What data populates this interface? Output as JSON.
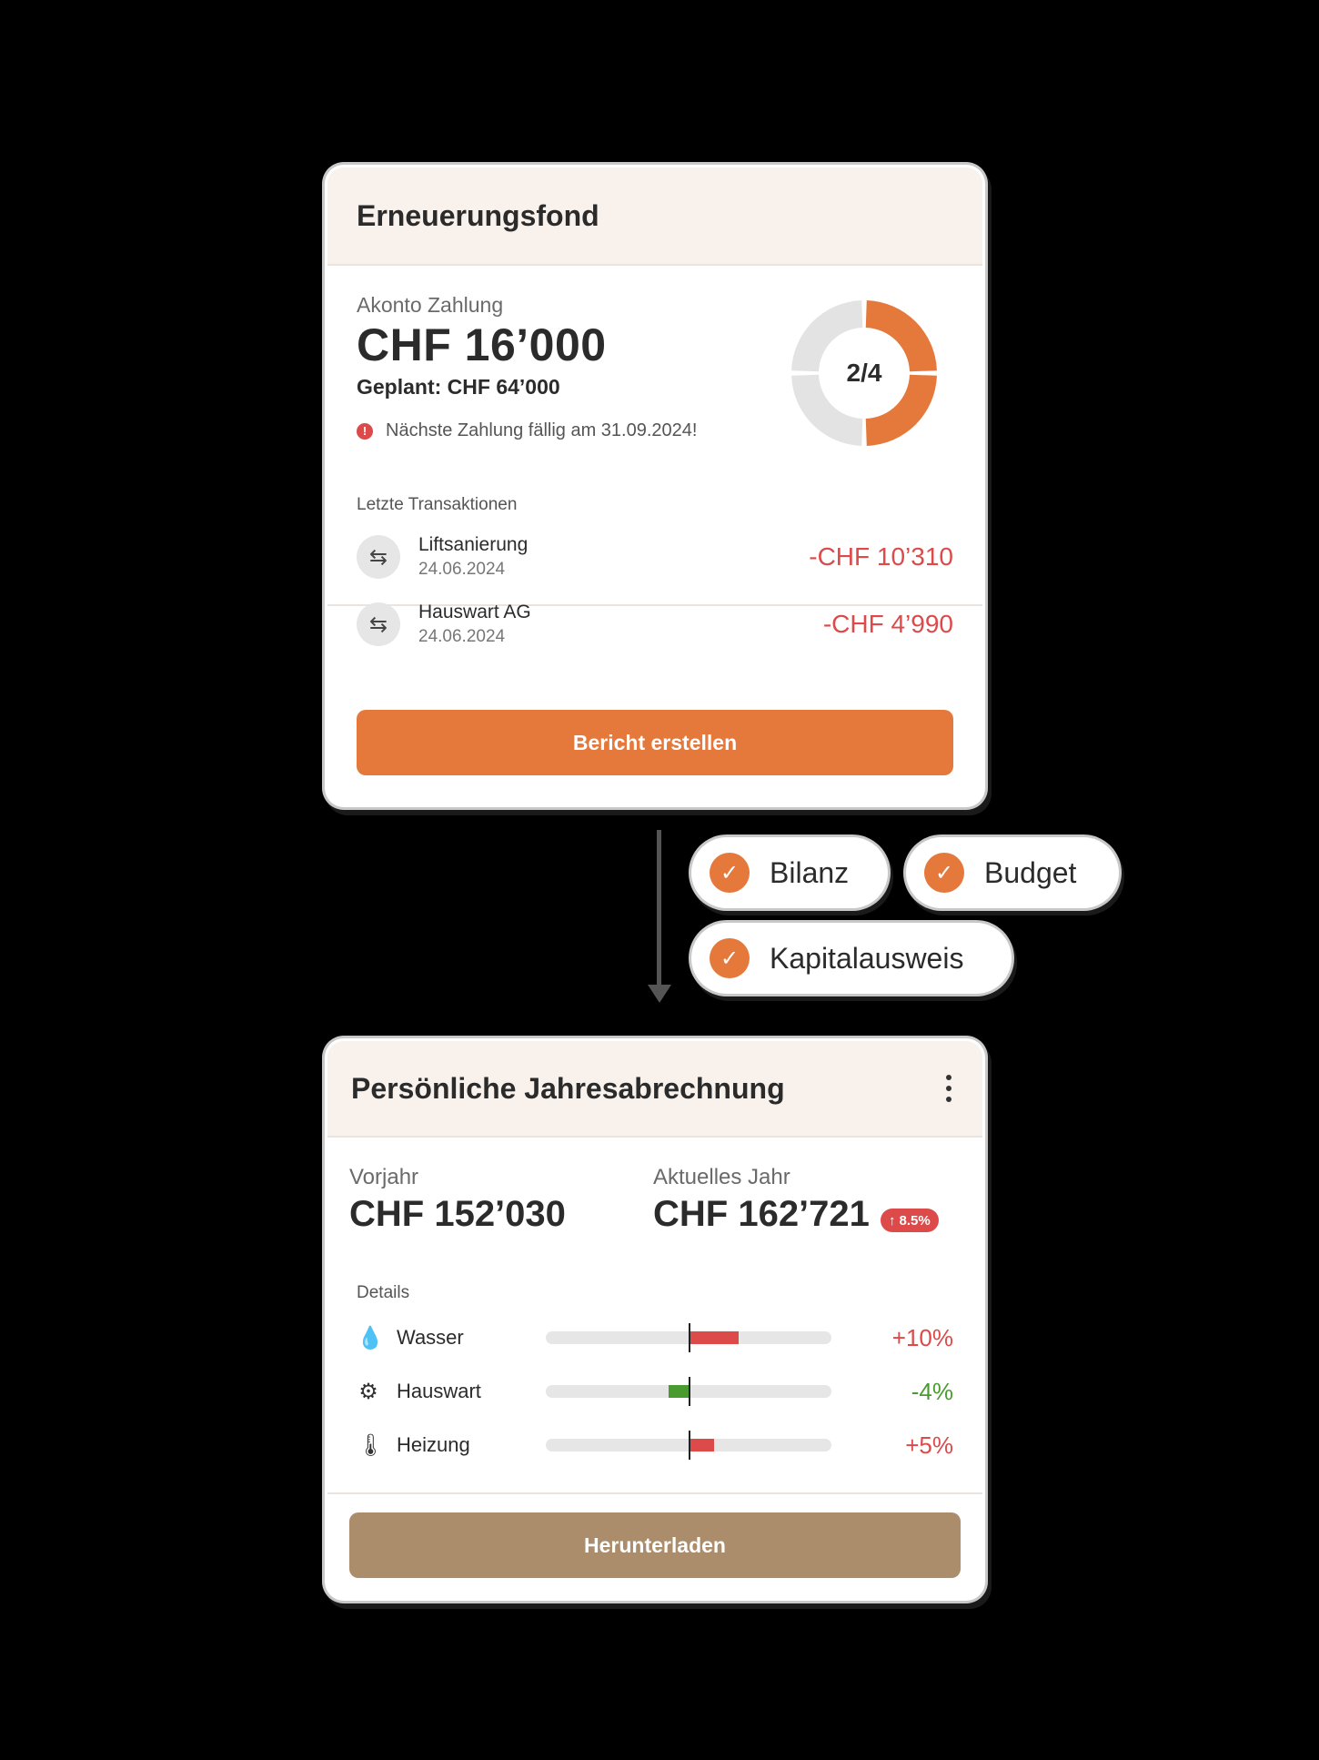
{
  "fund_card": {
    "title": "Erneuerungsfond",
    "akonto_label": "Akonto Zahlung",
    "akonto_amount": "CHF 16’000",
    "planned": "Geplant: CHF 64’000",
    "alert_text": "Nächste Zahlung fällig am 31.09.2024!",
    "progress": {
      "label": "2/4",
      "done": 2,
      "total": 4,
      "color_done": "#e5793c",
      "color_open": "#e3e3e3"
    },
    "transactions_label": "Letzte Transaktionen",
    "transactions": [
      {
        "name": "Liftsanierung",
        "date": "24.06.2024",
        "amount": "-CHF 10’310",
        "icon": "transfer-icon"
      },
      {
        "name": "Hauswart AG",
        "date": "24.06.2024",
        "amount": "-CHF 4’990",
        "icon": "transfer-icon"
      }
    ],
    "button_label": "Bericht erstellen",
    "accent": "#e5793c",
    "negative_color": "#dc4a4a"
  },
  "report_items": [
    {
      "label": "Bilanz",
      "checked": true
    },
    {
      "label": "Budget",
      "checked": true
    },
    {
      "label": "Kapitalausweis",
      "checked": true
    }
  ],
  "statement_card": {
    "title": "Persönliche Jahresabrechnung",
    "previous_label": "Vorjahr",
    "previous_amount": "CHF 152’030",
    "current_label": "Aktuelles Jahr",
    "current_amount": "CHF 162’721",
    "change_badge": "8.5%",
    "details_label": "Details",
    "details": [
      {
        "name": "Wasser",
        "icon": "water-drops-icon",
        "change_text": "+10%",
        "change": 10,
        "color": "#dc4a4a"
      },
      {
        "name": "Hauswart",
        "icon": "gear-icon",
        "change_text": "-4%",
        "change": -4,
        "color": "#4a9b2f"
      },
      {
        "name": "Heizung",
        "icon": "thermometer-icon",
        "change_text": "+5%",
        "change": 5,
        "color": "#dc4a4a"
      }
    ],
    "button_label": "Herunterladen",
    "button_color": "#ab8d6c"
  }
}
